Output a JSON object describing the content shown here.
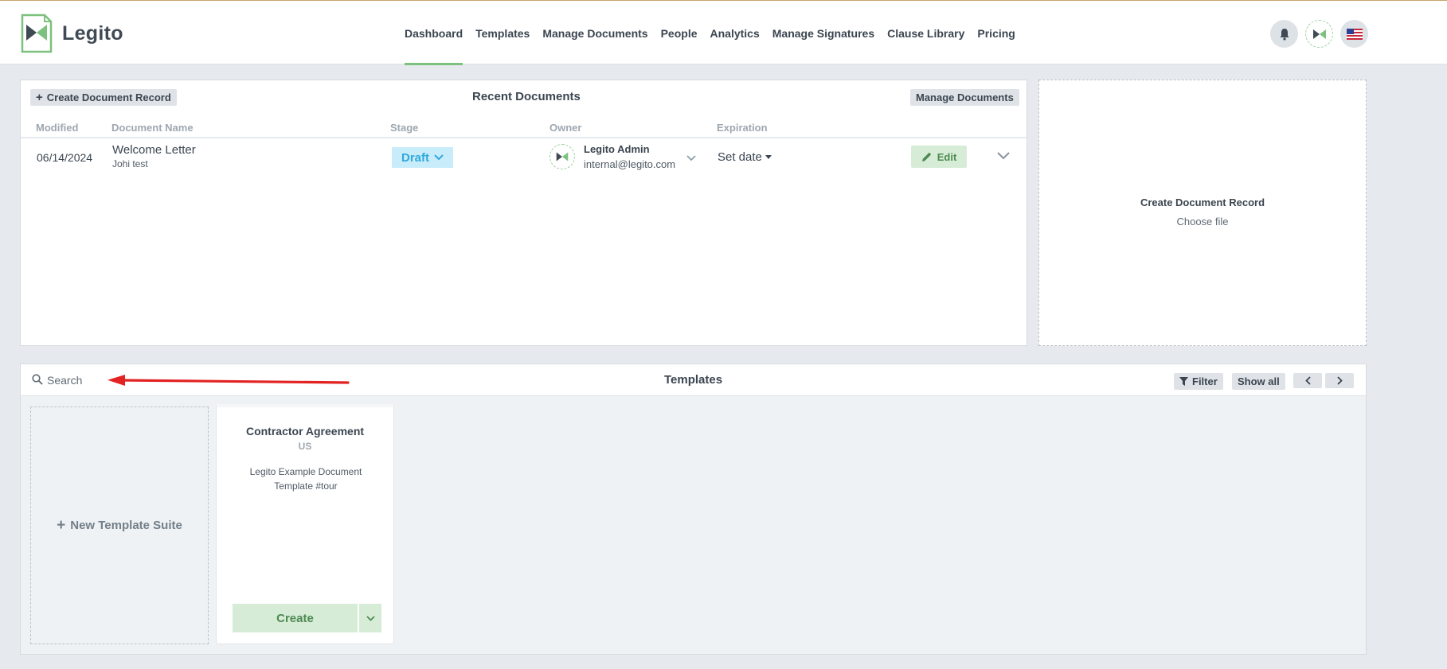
{
  "brand": {
    "name": "Legito",
    "accent": "#7cc17e"
  },
  "nav": {
    "items": [
      {
        "label": "Dashboard",
        "active": true
      },
      {
        "label": "Templates",
        "active": false
      },
      {
        "label": "Manage Documents",
        "active": false
      },
      {
        "label": "People",
        "active": false
      },
      {
        "label": "Analytics",
        "active": false
      },
      {
        "label": "Manage Signatures",
        "active": false
      },
      {
        "label": "Clause Library",
        "active": false
      },
      {
        "label": "Pricing",
        "active": false
      }
    ]
  },
  "header_icons": [
    "bell-icon",
    "legito-avatar-icon",
    "us-flag-icon"
  ],
  "recent": {
    "title": "Recent Documents",
    "create_label": "Create Document Record",
    "manage_label": "Manage Documents",
    "columns": [
      "Modified",
      "Document Name",
      "Stage",
      "Owner",
      "Expiration"
    ],
    "rows": [
      {
        "modified": "06/14/2024",
        "name": "Welcome Letter",
        "subtitle": "Johi test",
        "stage": "Draft",
        "owner_name": "Legito Admin",
        "owner_email": "internal@legito.com",
        "expiration": "Set date",
        "edit_label": "Edit"
      }
    ]
  },
  "upload": {
    "title": "Create Document Record",
    "link": "Choose file"
  },
  "templates": {
    "title": "Templates",
    "search_placeholder": "Search",
    "filter_label": "Filter",
    "show_all_label": "Show all",
    "new_suite_label": "New Template Suite",
    "cards": [
      {
        "title": "Contractor Agreement",
        "region": "US",
        "description": "Legito Example Document Template #tour",
        "create_label": "Create"
      }
    ]
  },
  "colors": {
    "stage_draft_bg": "#c9ecfb",
    "stage_draft_text": "#2fa9dd",
    "annotation_arrow": "#e32222"
  }
}
